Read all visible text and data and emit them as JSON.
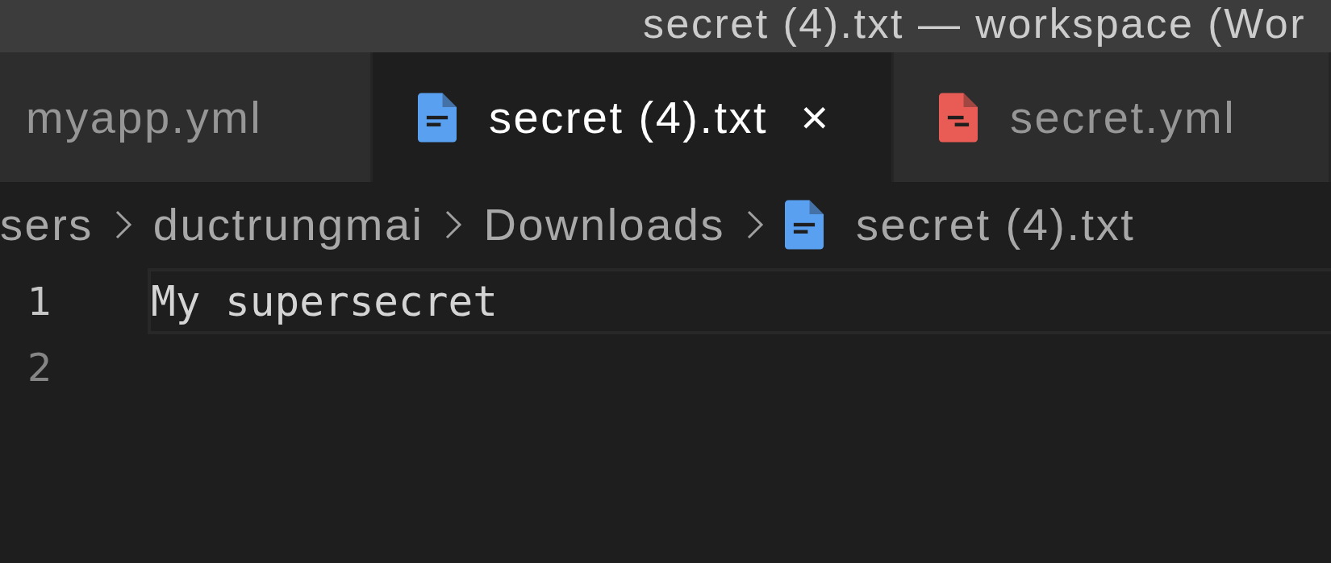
{
  "window": {
    "title": "secret (4).txt — workspace (Wor"
  },
  "tabs": [
    {
      "label": "myapp.yml",
      "selected": false
    },
    {
      "label": "secret (4).txt",
      "kind": "text",
      "selected": true,
      "close": "×"
    },
    {
      "label": "secret.yml",
      "kind": "yaml",
      "selected": false
    }
  ],
  "breadcrumbs": [
    {
      "label": "sers"
    },
    {
      "label": "ductrungmai"
    },
    {
      "label": "Downloads"
    },
    {
      "label": "secret (4).txt",
      "kind": "text"
    }
  ],
  "editor": {
    "lines": [
      {
        "number": "1",
        "text": "My supersecret",
        "current": true
      },
      {
        "number": "2",
        "current": false
      }
    ]
  }
}
